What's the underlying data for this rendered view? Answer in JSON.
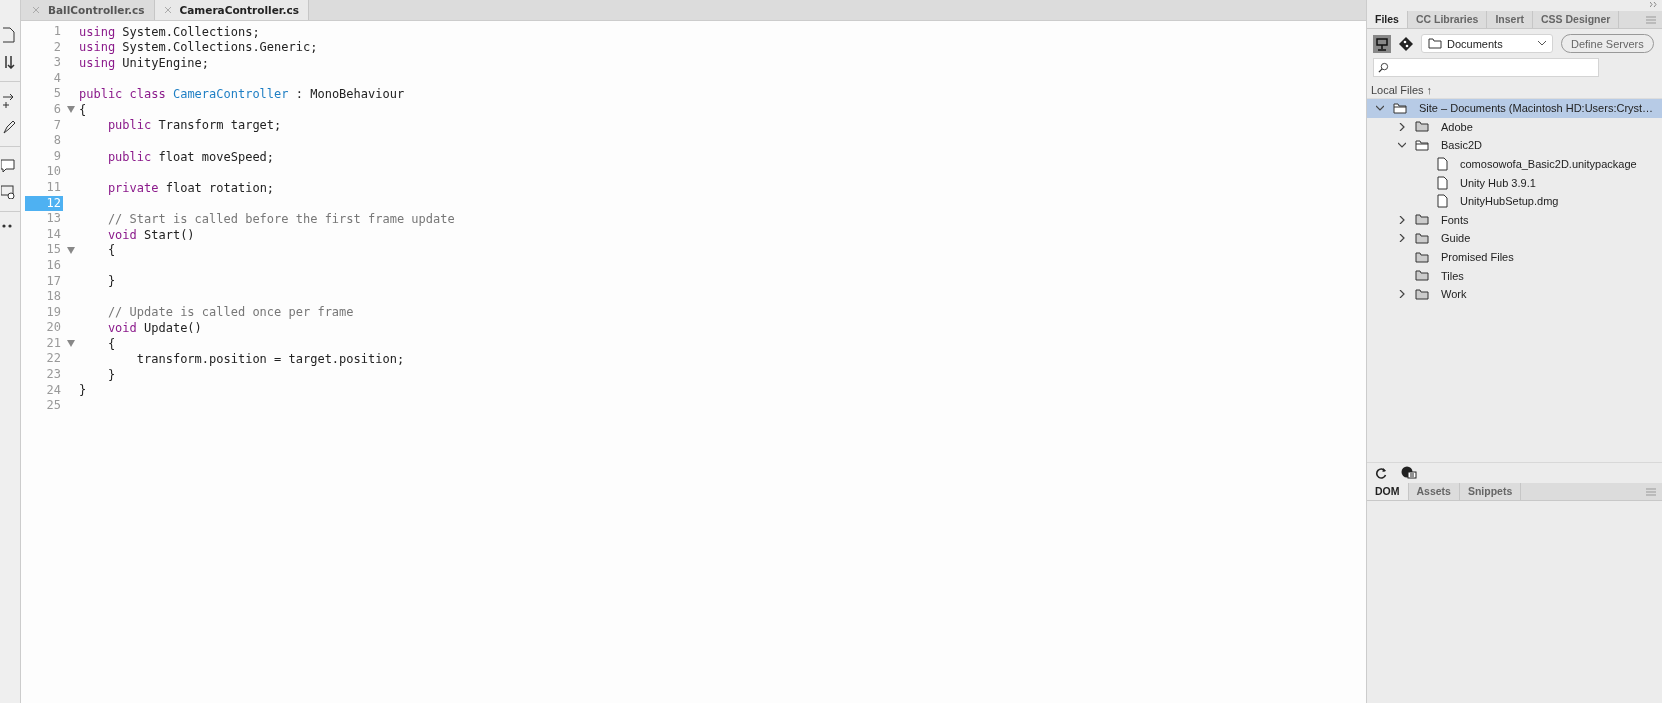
{
  "editor_tabs": [
    {
      "label": "BallController.cs",
      "selected": false
    },
    {
      "label": "CameraController.cs",
      "selected": true
    }
  ],
  "code": {
    "lines": [
      {
        "num": "1",
        "fold": false,
        "selected": false,
        "tokens": [
          {
            "kind": "kw",
            "text": "using"
          },
          {
            "kind": "plain",
            "text": " System.Collections;"
          }
        ]
      },
      {
        "num": "2",
        "fold": false,
        "selected": false,
        "tokens": [
          {
            "kind": "kw",
            "text": "using"
          },
          {
            "kind": "plain",
            "text": " System.Collections.Generic;"
          }
        ]
      },
      {
        "num": "3",
        "fold": false,
        "selected": false,
        "tokens": [
          {
            "kind": "kw",
            "text": "using"
          },
          {
            "kind": "plain",
            "text": " UnityEngine;"
          }
        ]
      },
      {
        "num": "4",
        "fold": false,
        "selected": false
      },
      {
        "num": "5",
        "fold": false,
        "selected": false,
        "tokens": [
          {
            "kind": "kw",
            "text": "public class"
          },
          {
            "kind": "type",
            "text": " CameraController"
          },
          {
            "kind": "plain",
            "text": " : MonoBehaviour"
          }
        ]
      },
      {
        "num": "6",
        "fold": true,
        "selected": false,
        "tokens": [
          {
            "kind": "plain",
            "text": "{"
          }
        ]
      },
      {
        "num": "7",
        "fold": false,
        "selected": false,
        "tokens": [
          {
            "kind": "kw",
            "text": "    public"
          },
          {
            "kind": "plain",
            "text": " Transform target;"
          }
        ]
      },
      {
        "num": "8",
        "fold": false,
        "selected": false
      },
      {
        "num": "9",
        "fold": false,
        "selected": false,
        "tokens": [
          {
            "kind": "kw",
            "text": "    public"
          },
          {
            "kind": "plain",
            "text": " float moveSpeed;"
          }
        ]
      },
      {
        "num": "10",
        "fold": false,
        "selected": false
      },
      {
        "num": "11",
        "fold": false,
        "selected": false,
        "tokens": [
          {
            "kind": "kw",
            "text": "    private"
          },
          {
            "kind": "plain",
            "text": " float rotation;"
          }
        ]
      },
      {
        "num": "12",
        "fold": false,
        "selected": true
      },
      {
        "num": "13",
        "fold": false,
        "selected": false,
        "tokens": [
          {
            "kind": "comment",
            "text": "    // Start is called before the first frame update"
          }
        ]
      },
      {
        "num": "14",
        "fold": false,
        "selected": false,
        "tokens": [
          {
            "kind": "kw",
            "text": "    void"
          },
          {
            "kind": "plain",
            "text": " Start()"
          }
        ]
      },
      {
        "num": "15",
        "fold": true,
        "selected": false,
        "tokens": [
          {
            "kind": "plain",
            "text": "    {"
          }
        ]
      },
      {
        "num": "16",
        "fold": false,
        "selected": false
      },
      {
        "num": "17",
        "fold": false,
        "selected": false,
        "tokens": [
          {
            "kind": "plain",
            "text": "    }"
          }
        ]
      },
      {
        "num": "18",
        "fold": false,
        "selected": false
      },
      {
        "num": "19",
        "fold": false,
        "selected": false,
        "tokens": [
          {
            "kind": "comment",
            "text": "    // Update is called once per frame"
          }
        ]
      },
      {
        "num": "20",
        "fold": false,
        "selected": false,
        "tokens": [
          {
            "kind": "kw",
            "text": "    void"
          },
          {
            "kind": "plain",
            "text": " Update()"
          }
        ]
      },
      {
        "num": "21",
        "fold": true,
        "selected": false,
        "tokens": [
          {
            "kind": "plain",
            "text": "    {"
          }
        ]
      },
      {
        "num": "22",
        "fold": false,
        "selected": false,
        "tokens": [
          {
            "kind": "plain",
            "text": "        transform.position = target.position;"
          }
        ]
      },
      {
        "num": "23",
        "fold": false,
        "selected": false,
        "tokens": [
          {
            "kind": "plain",
            "text": "    }"
          }
        ]
      },
      {
        "num": "24",
        "fold": false,
        "selected": false,
        "tokens": [
          {
            "kind": "plain",
            "text": "}"
          }
        ]
      },
      {
        "num": "25",
        "fold": false,
        "selected": false
      }
    ]
  },
  "panel": {
    "tabs": [
      {
        "label": "Files",
        "selected": true
      },
      {
        "label": "CC Libraries",
        "selected": false
      },
      {
        "label": "Insert",
        "selected": false
      },
      {
        "label": "CSS Designer",
        "selected": false
      }
    ],
    "site_select": "Documents",
    "define_button": "Define Servers",
    "local_files": "Local Files",
    "sort_arrow": "↑",
    "tree": [
      {
        "kind": "folder",
        "label": "Site – Documents (Macintosh HD:Users:Cryst…",
        "collapsible": true,
        "expanded": true,
        "selected": true,
        "children": [
          {
            "kind": "folder",
            "label": "Adobe",
            "collapsible": true,
            "expanded": false,
            "selected": false
          },
          {
            "kind": "folder",
            "label": "Basic2D",
            "collapsible": true,
            "expanded": true,
            "selected": false,
            "children": [
              {
                "kind": "file",
                "label": "comosowofa_Basic2D.unitypackage",
                "collapsible": false,
                "expanded": false,
                "selected": false
              },
              {
                "kind": "file",
                "label": "Unity Hub 3.9.1",
                "collapsible": false,
                "expanded": false,
                "selected": false
              },
              {
                "kind": "file",
                "label": "UnityHubSetup.dmg",
                "collapsible": false,
                "expanded": false,
                "selected": false
              }
            ]
          },
          {
            "kind": "folder",
            "label": "Fonts",
            "collapsible": true,
            "expanded": false,
            "selected": false
          },
          {
            "kind": "folder",
            "label": "Guide",
            "collapsible": true,
            "expanded": false,
            "selected": false
          },
          {
            "kind": "folder",
            "label": "Promised Files",
            "collapsible": false,
            "expanded": false,
            "selected": false
          },
          {
            "kind": "folder",
            "label": "Tiles",
            "collapsible": false,
            "expanded": false,
            "selected": false
          },
          {
            "kind": "folder",
            "label": "Work",
            "collapsible": true,
            "expanded": false,
            "selected": false
          }
        ]
      }
    ],
    "bottom_tabs": [
      {
        "label": "DOM",
        "selected": true
      },
      {
        "label": "Assets",
        "selected": false
      },
      {
        "label": "Snippets",
        "selected": false
      }
    ]
  }
}
